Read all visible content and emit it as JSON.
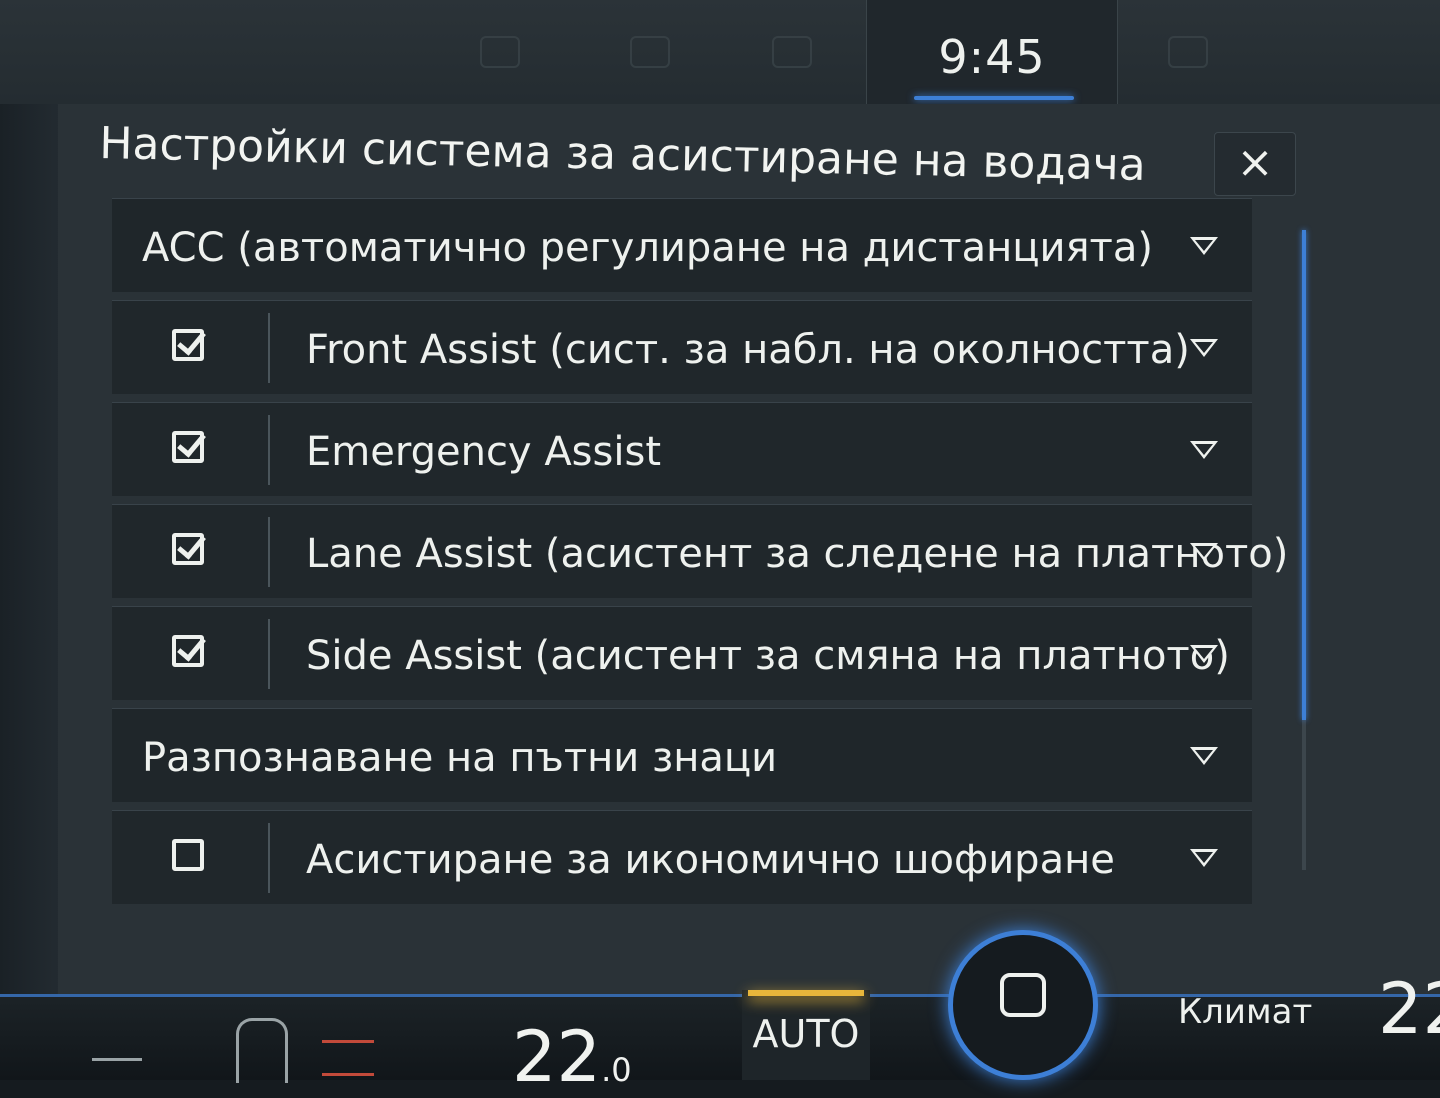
{
  "status": {
    "clock": "9:45"
  },
  "dialog": {
    "title": "Настройки система за асистиране на водача",
    "close_label": "×"
  },
  "rows": [
    {
      "type": "group",
      "label": "ACC (автоматично регулиране на дистанцията)",
      "checked": null
    },
    {
      "type": "item",
      "label": "Front Assist (сист. за набл. на околността)",
      "checked": true
    },
    {
      "type": "item",
      "label": "Emergency Assist",
      "checked": true
    },
    {
      "type": "item",
      "label": "Lane Assist (асистент за следене на платното)",
      "checked": true
    },
    {
      "type": "item",
      "label": "Side Assist (асистент за смяна на платното)",
      "checked": true
    },
    {
      "type": "group",
      "label": "Разпознаване на пътни знаци",
      "checked": null
    },
    {
      "type": "item",
      "label": "Асистиране за икономично шофиране",
      "checked": false
    }
  ],
  "bottom": {
    "temp_left_main": "22",
    "temp_left_decimal": ".0",
    "auto_label": "AUTO",
    "climate_label": "Климат",
    "temp_right": "22"
  },
  "colors": {
    "accent": "#3d7fd6",
    "auto_led": "#e8b63b",
    "heat": "#c24a3a"
  },
  "icons": {
    "row_expand": "chevron-down-icon",
    "check": "checkbox-icon",
    "home": "home-icon",
    "seat": "seat-icon"
  }
}
